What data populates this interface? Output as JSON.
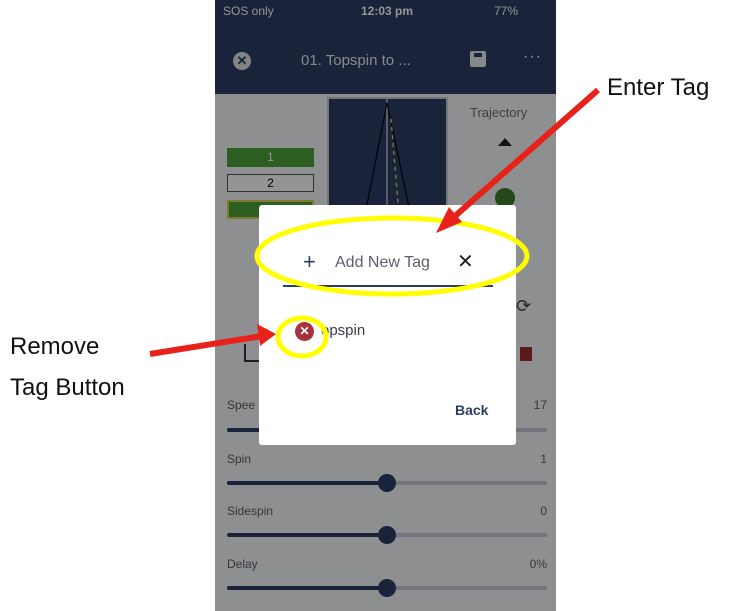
{
  "annotations": {
    "enter_tag": "Enter Tag",
    "remove_tag_line1": "Remove",
    "remove_tag_line2": "Tag Button"
  },
  "status_bar": {
    "carrier": "SOS only",
    "time": "12:03 pm",
    "battery": "77%"
  },
  "app_bar": {
    "title": "01. Topspin to ...",
    "close_icon": "close-icon",
    "save_icon": "save-icon",
    "more_icon": "more-icon",
    "more_glyph": "···"
  },
  "editor": {
    "trajectory_label": "Trajectory",
    "rows": [
      "1",
      "2"
    ]
  },
  "sliders": [
    {
      "label": "Speed",
      "visible_label": "Spee",
      "value": "17",
      "level": 0.5
    },
    {
      "label": "Spin",
      "value": "1",
      "level": 0.5
    },
    {
      "label": "Sidespin",
      "value": "0",
      "level": 0.5
    },
    {
      "label": "Delay",
      "value": "0%",
      "level": 0.5
    }
  ],
  "dialog": {
    "add_label": "Add New Tag",
    "plus_glyph": "+",
    "clear_glyph": "✕",
    "tags": [
      {
        "name": "Topspin",
        "visible_name": "opspin"
      }
    ],
    "back_label": "Back"
  },
  "colors": {
    "brand": "#2b3f66",
    "highlight": "#ffff00",
    "arrow": "#e8221a",
    "row_green": "#4aa338",
    "remove": "#a5323c"
  }
}
